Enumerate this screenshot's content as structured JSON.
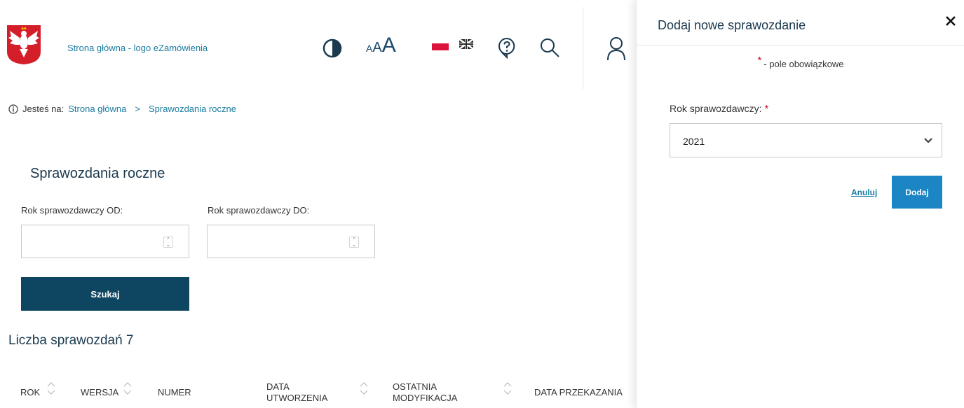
{
  "header": {
    "logo_link_text": "Strona główna - logo eZamówienia",
    "font_size_labels": [
      "A",
      "A",
      "A"
    ],
    "icons": {
      "contrast": "contrast-icon",
      "flag_pl": "flag-pl-icon",
      "flag_uk": "flag-uk-icon",
      "help": "help-icon",
      "search": "search-icon",
      "user": "user-icon"
    }
  },
  "breadcrumb": {
    "prefix": "Jesteś na:",
    "items": [
      "Strona główna",
      "Sprawozdania roczne"
    ],
    "separator": ">"
  },
  "main": {
    "title": "Sprawozdania roczne",
    "from_label": "Rok sprawozdawczy OD:",
    "to_label": "Rok sprawozdawczy DO:",
    "from_value": "",
    "to_value": "",
    "search_button": "Szukaj",
    "count_text": "Liczba sprawozdań 7"
  },
  "table": {
    "columns": [
      [
        "ROK"
      ],
      [
        "WERSJA"
      ],
      [
        "NUMER"
      ],
      [
        "DATA",
        "UTWORZENIA"
      ],
      [
        "OSTATNIA",
        "MODYFIKACJA"
      ],
      [
        "DATA PRZEKAZANIA"
      ]
    ]
  },
  "panel": {
    "title": "Dodaj nowe sprawozdanie",
    "required_star": "*",
    "required_note": "- pole obowiązkowe",
    "year_label": "Rok sprawozdawczy:",
    "year_value": "2021",
    "cancel_label": "Anuluj",
    "add_label": "Dodaj"
  },
  "colors": {
    "primary_dark": "#0e4561",
    "accent_blue": "#1b86c3",
    "link": "#1b7ca0",
    "required": "#c8102e"
  }
}
